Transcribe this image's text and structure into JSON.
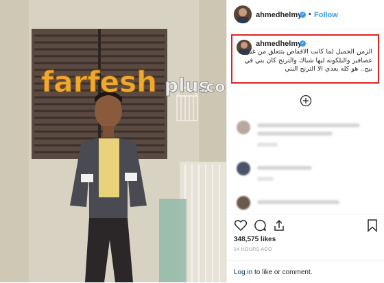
{
  "post": {
    "author": "ahmedhelmy",
    "separator": "•",
    "follow_label": "Follow",
    "verified_icon": "verified-badge-icon",
    "caption_author": "ahmedhelmy",
    "caption_text": "الزمن الجميل لما كانت الاقفاص بتتعلق من غير عصافير والبلكونه ليها شباك والترنج كان بني في بيج.. هو كله يعدي الا الترنج البني",
    "likes": "348,575 likes",
    "time": "14 HOURS AGO",
    "login_link": "Log in",
    "login_rest": " to like or comment."
  },
  "watermark": {
    "text_main": "farfesh",
    "text_sub": "plus",
    "text_end": ".com"
  },
  "colors": {
    "accent": "#3897f0",
    "highlight_box": "#dd2222",
    "watermark_orange": "#f0a830"
  },
  "icons": [
    "heart-icon",
    "comment-icon",
    "share-icon",
    "bookmark-icon",
    "load-more-comments-icon"
  ]
}
